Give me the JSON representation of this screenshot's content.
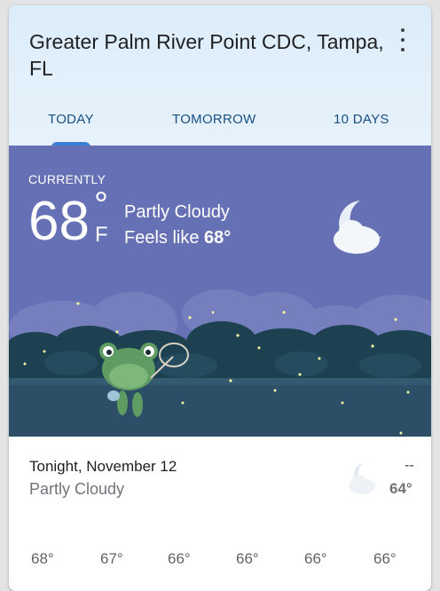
{
  "header": {
    "location": "Greater Palm River Point CDC, Tampa, FL",
    "menu_icon": "more-vert-icon"
  },
  "tabs": [
    {
      "label": "TODAY",
      "selected": true
    },
    {
      "label": "TOMORROW",
      "selected": false
    },
    {
      "label": "10 DAYS",
      "selected": false
    }
  ],
  "current": {
    "label": "CURRENTLY",
    "temp": "68",
    "degree": "°",
    "unit": "F",
    "condition": "Partly Cloudy",
    "feels_prefix": "Feels like",
    "feels_value": "68°",
    "icon": "moon-cloud-icon"
  },
  "tonight": {
    "title": "Tonight, November 12",
    "condition": "Partly Cloudy",
    "high": "--",
    "low": "64°",
    "icon": "moon-cloud-icon"
  },
  "hourly": [
    "68°",
    "67°",
    "66°",
    "66°",
    "66°",
    "66°"
  ],
  "colors": {
    "header_bg": "#dcedf9",
    "tab_text": "#1a4f82",
    "tab_indicator": "#3a80d6",
    "sky": "#6670b4",
    "trees": "#1e4152"
  }
}
